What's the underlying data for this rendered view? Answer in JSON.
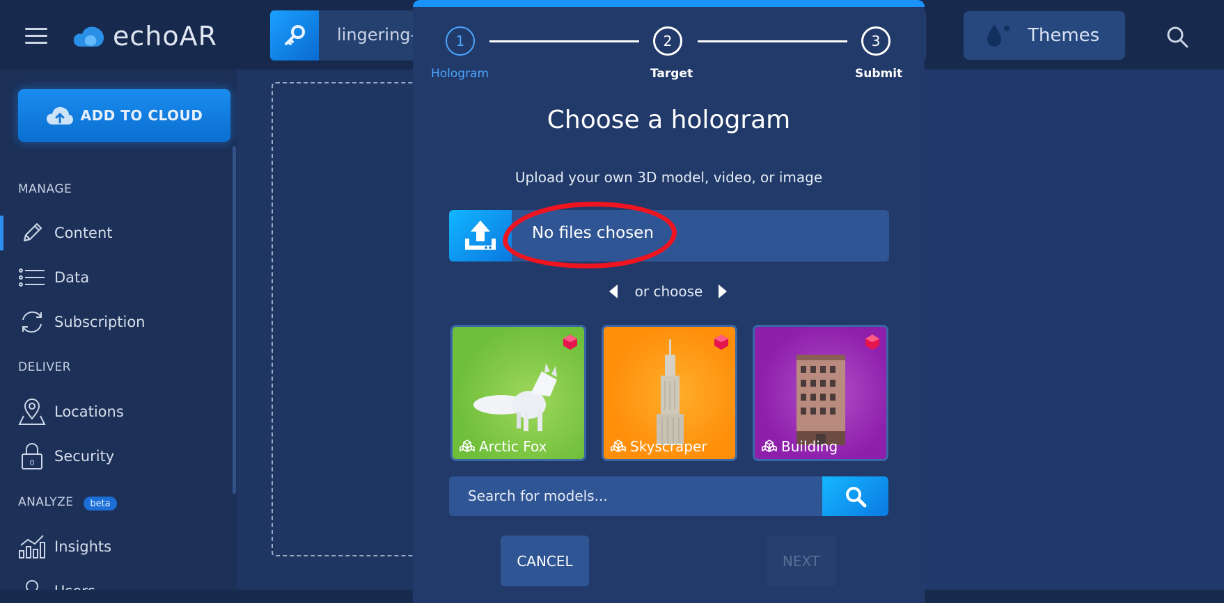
{
  "app": {
    "logo_text": "echoAR"
  },
  "header": {
    "project_name": "lingering-p",
    "themes_label": "Themes"
  },
  "sidebar": {
    "add_button": "ADD TO CLOUD",
    "sections": {
      "manage": "MANAGE",
      "deliver": "DELIVER",
      "analyze": "ANALYZE",
      "beta": "beta"
    },
    "items": [
      {
        "label": "Content",
        "icon": "pencil-icon"
      },
      {
        "label": "Data",
        "icon": "list-icon"
      },
      {
        "label": "Subscription",
        "icon": "refresh-icon"
      },
      {
        "label": "Locations",
        "icon": "map-pin-icon"
      },
      {
        "label": "Security",
        "icon": "lock-icon"
      },
      {
        "label": "Insights",
        "icon": "chart-icon"
      },
      {
        "label": "Users",
        "icon": "user-icon"
      }
    ]
  },
  "modal": {
    "steps": [
      {
        "number": "1",
        "label": "Hologram"
      },
      {
        "number": "2",
        "label": "Target"
      },
      {
        "number": "3",
        "label": "Submit"
      }
    ],
    "title": "Choose a hologram",
    "subtitle": "Upload your own 3D model, video, or image",
    "upload_status": "No files chosen",
    "or_choose": "or choose",
    "models": [
      {
        "name": "Arctic Fox"
      },
      {
        "name": "Skyscraper"
      },
      {
        "name": "Building"
      }
    ],
    "search_placeholder": "Search for models...",
    "cancel_label": "CANCEL",
    "next_label": "NEXT"
  },
  "colors": {
    "accent": "#1b93ff",
    "background": "#1f3562",
    "annotation": "#ee1420"
  }
}
